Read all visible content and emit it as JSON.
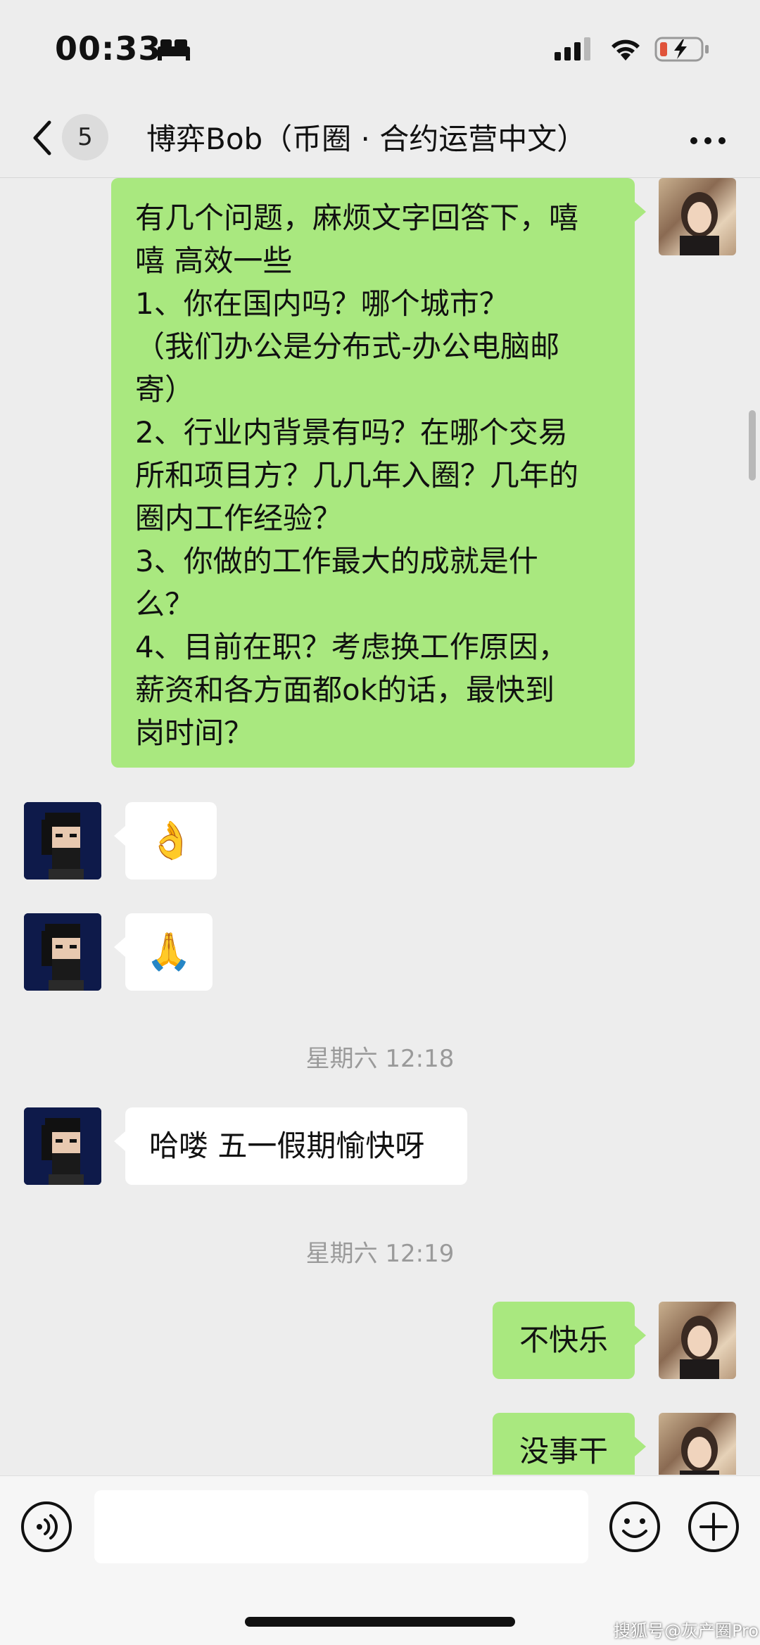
{
  "status_bar": {
    "time": "00:33",
    "icons": [
      "sleep-focus-icon",
      "cellular-signal-icon",
      "wifi-icon",
      "battery-charging-icon"
    ]
  },
  "nav": {
    "back_icon": "chevron-left-icon",
    "unread_count": "5",
    "title": "博弈Bob（币圈 · 合约运营中文）",
    "more_icon": "more-dots-icon"
  },
  "messages": [
    {
      "sender": "me",
      "type": "text",
      "text": "有几个问题，麻烦文字回答下，嘻\n嘻 高效一些\n1、你在国内吗？哪个城市？\n（我们办公是分布式-办公电脑邮\n寄）\n2、行业内背景有吗？在哪个交易\n所和项目方？几几年入圈？几年的\n圈内工作经验？\n3、你做的工作最大的成就是什\n么？\n4、目前在职？考虑换工作原因，\n薪资和各方面都ok的话，最快到\n岗时间？"
    },
    {
      "sender": "bob",
      "type": "emoji",
      "text": "👌"
    },
    {
      "sender": "bob",
      "type": "emoji",
      "text": "🙏"
    },
    {
      "type": "timestamp",
      "text": "星期六 12:18"
    },
    {
      "sender": "bob",
      "type": "text",
      "text": "哈喽 五一假期愉快呀"
    },
    {
      "type": "timestamp",
      "text": "星期六 12:19"
    },
    {
      "sender": "me",
      "type": "text",
      "text": "不快乐"
    },
    {
      "sender": "me",
      "type": "text",
      "text": "没事干"
    }
  ],
  "input_bar": {
    "voice_icon": "voice-icon",
    "input_value": "",
    "emoji_icon": "emoji-icon",
    "plus_icon": "plus-icon"
  },
  "watermark": "搜狐号@灰产圈Pro",
  "colors": {
    "background": "#ededed",
    "my_bubble": "#a9e87f",
    "their_bubble": "#ffffff",
    "timestamp": "#9a9a9a"
  }
}
